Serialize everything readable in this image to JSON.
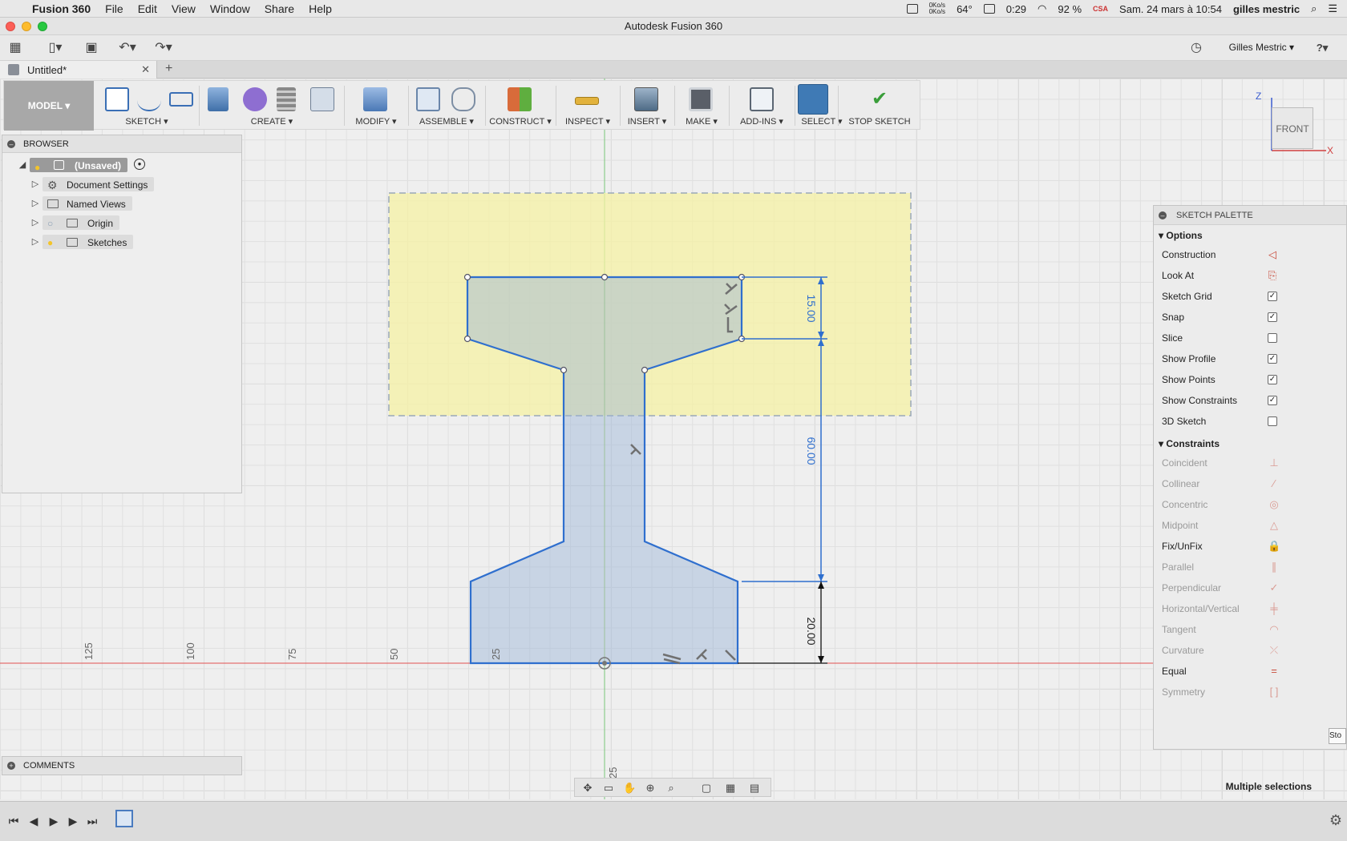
{
  "menubar": {
    "app_name": "Fusion 360",
    "items": [
      "File",
      "Edit",
      "View",
      "Window",
      "Share",
      "Help"
    ],
    "net_up": "0Ko/s",
    "net_down": "0Ko/s",
    "temperature": "64°",
    "battery_time": "0:29",
    "battery_pct": "92 %",
    "keyboard": "CSA",
    "datetime": "Sam. 24 mars à 10:54",
    "user": "gilles mestric"
  },
  "window": {
    "title": "Autodesk Fusion 360"
  },
  "quick_access": {
    "user_label": "Gilles Mestric ▾",
    "help": "?"
  },
  "tabs": {
    "doc_title": "Untitled*",
    "add": "+"
  },
  "toolbar": {
    "workspace": "MODEL ▾",
    "groups": [
      "SKETCH ▾",
      "CREATE ▾",
      "MODIFY ▾",
      "ASSEMBLE ▾",
      "CONSTRUCT ▾",
      "INSPECT ▾",
      "INSERT ▾",
      "MAKE ▾",
      "ADD-INS ▾",
      "SELECT ▾",
      "STOP SKETCH"
    ]
  },
  "browser": {
    "header": "BROWSER",
    "root": "(Unsaved)",
    "nodes": [
      "Document Settings",
      "Named Views",
      "Origin",
      "Sketches"
    ]
  },
  "comments": {
    "header": "COMMENTS"
  },
  "palette": {
    "header": "SKETCH PALETTE",
    "options_title": "Options",
    "options": [
      {
        "label": "Construction",
        "type": "icon",
        "icon": "construction-icon"
      },
      {
        "label": "Look At",
        "type": "icon",
        "icon": "look-at-icon"
      },
      {
        "label": "Sketch Grid",
        "type": "check",
        "checked": true
      },
      {
        "label": "Snap",
        "type": "check",
        "checked": true
      },
      {
        "label": "Slice",
        "type": "check",
        "checked": false
      },
      {
        "label": "Show Profile",
        "type": "check",
        "checked": true
      },
      {
        "label": "Show Points",
        "type": "check",
        "checked": true
      },
      {
        "label": "Show Constraints",
        "type": "check",
        "checked": true
      },
      {
        "label": "3D Sketch",
        "type": "check",
        "checked": false
      }
    ],
    "constraints_title": "Constraints",
    "constraints": [
      {
        "label": "Coincident",
        "enabled": false,
        "icon": "coincident-icon",
        "glyph": "⊥"
      },
      {
        "label": "Collinear",
        "enabled": false,
        "icon": "collinear-icon",
        "glyph": "⁄"
      },
      {
        "label": "Concentric",
        "enabled": false,
        "icon": "concentric-icon",
        "glyph": "◎"
      },
      {
        "label": "Midpoint",
        "enabled": false,
        "icon": "midpoint-icon",
        "glyph": "△"
      },
      {
        "label": "Fix/UnFix",
        "enabled": true,
        "icon": "lock-icon",
        "glyph": "🔒"
      },
      {
        "label": "Parallel",
        "enabled": false,
        "icon": "parallel-icon",
        "glyph": "∥"
      },
      {
        "label": "Perpendicular",
        "enabled": false,
        "icon": "perpendicular-icon",
        "glyph": "✓"
      },
      {
        "label": "Horizontal/Vertical",
        "enabled": false,
        "icon": "horizontal-vertical-icon",
        "glyph": "╪"
      },
      {
        "label": "Tangent",
        "enabled": false,
        "icon": "tangent-icon",
        "glyph": "◠"
      },
      {
        "label": "Curvature",
        "enabled": false,
        "icon": "curvature-icon",
        "glyph": "⤫"
      },
      {
        "label": "Equal",
        "enabled": true,
        "icon": "equal-icon",
        "glyph": "="
      },
      {
        "label": "Symmetry",
        "enabled": false,
        "icon": "symmetry-icon",
        "glyph": "[ ]"
      }
    ],
    "stop_label": "Sto"
  },
  "viewcube": {
    "face": "FRONT",
    "axis_z": "Z",
    "axis_x": "X"
  },
  "sketch": {
    "dimensions": [
      "15.00",
      "60.00",
      "20.00"
    ],
    "ruler_labels": [
      "125",
      "100",
      "75",
      "50",
      "25"
    ],
    "bottom_ruler": "25"
  },
  "status": {
    "text": "Multiple selections"
  }
}
